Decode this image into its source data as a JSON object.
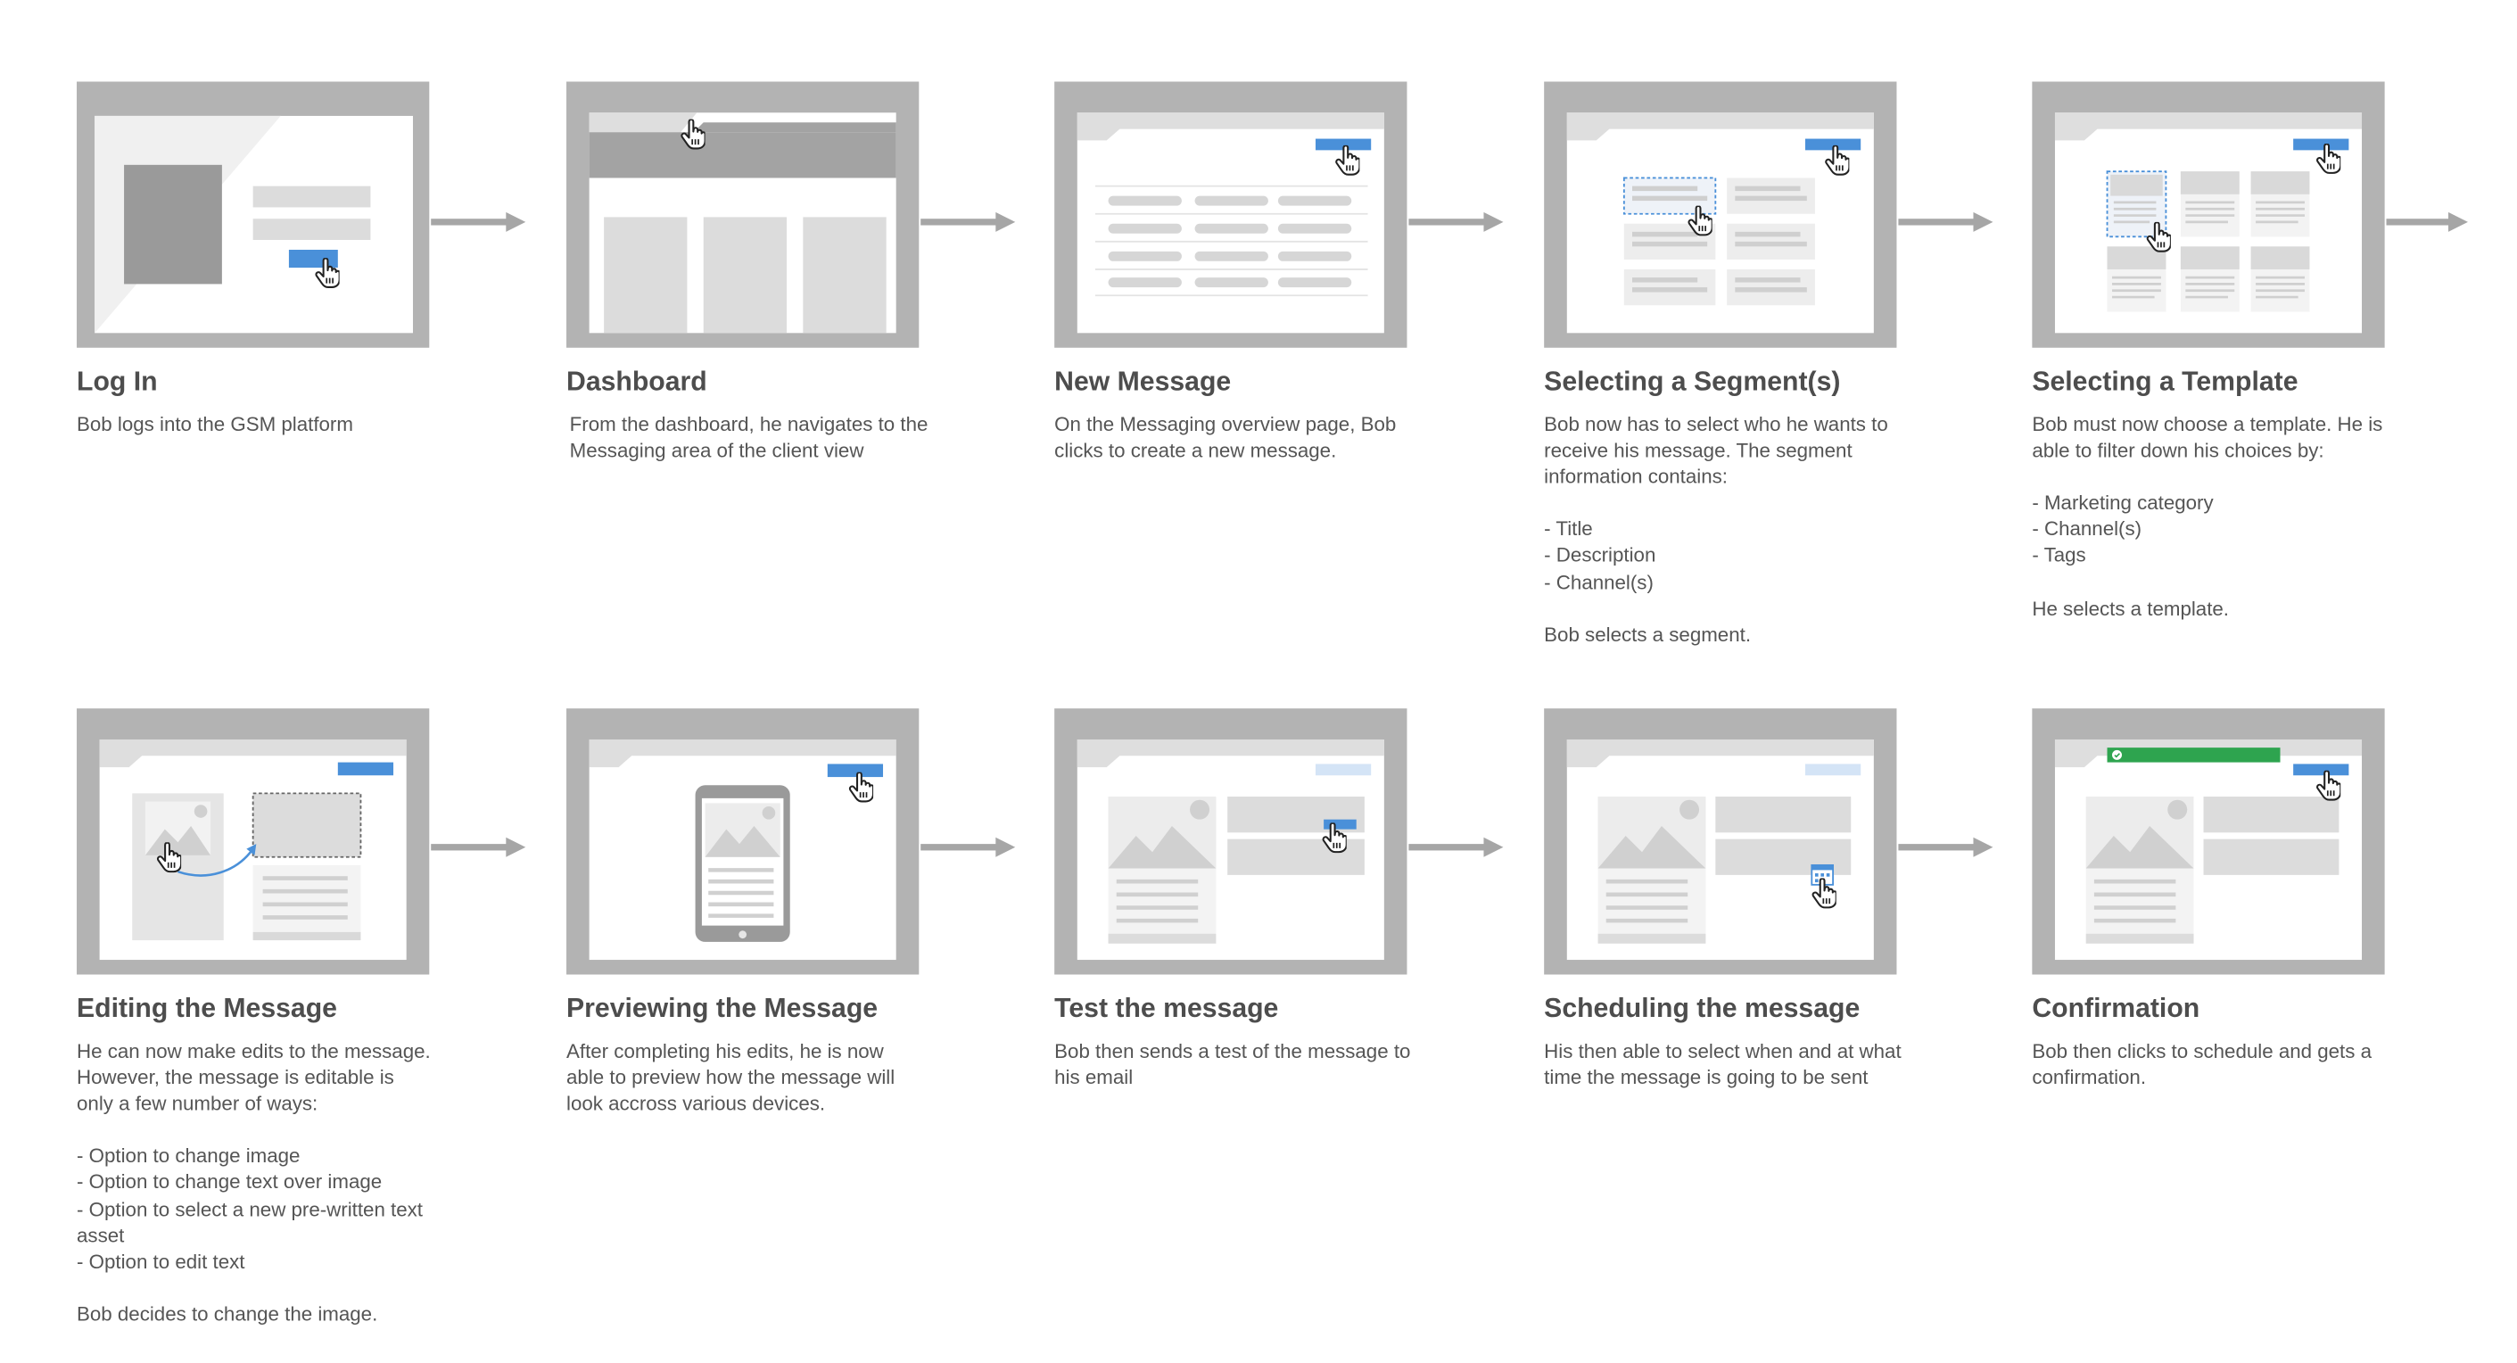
{
  "steps": [
    {
      "title": "Log In",
      "desc": "Bob logs into the GSM platform"
    },
    {
      "title": "Dashboard",
      "desc": "From the dashboard, he navigates to the Messaging area of the client view"
    },
    {
      "title": "New Message",
      "desc": "On the Messaging overview page, Bob clicks to create a new message."
    },
    {
      "title": "Selecting a Segment(s)",
      "desc": "Bob now has to select who he wants to receive his message. The segment information contains:\n\n- Title\n- Description\n- Channel(s)\n\nBob selects a segment."
    },
    {
      "title": "Selecting a Template",
      "desc": "Bob must now choose a template. He is able to filter down his choices by:\n\n- Marketing category\n- Channel(s)\n- Tags\n\nHe selects a template."
    },
    {
      "title": "Editing the Message",
      "desc": "He can now make edits to the message. However, the message is editable is only a few number of ways:\n\n- Option to change image\n- Option to change text over image\n- Option to select a new pre-written text asset\n- Option to edit text\n\nBob decides to change the image."
    },
    {
      "title": "Previewing the Message",
      "desc": "After completing his edits, he is now able to preview how the message will look accross various devices."
    },
    {
      "title": "Test the message",
      "desc": "Bob then sends a test of the message to his email"
    },
    {
      "title": "Scheduling the message",
      "desc": "His then able to select when and at what time the message is going to be sent"
    },
    {
      "title": "Confirmation",
      "desc": "Bob then clicks to schedule and gets a confirmation."
    }
  ],
  "icons": {
    "cursor": "hand-pointer-icon",
    "calendar": "calendar-icon",
    "check": "check-icon"
  },
  "colors": {
    "frame": "#b3b3b3",
    "accent": "#4a90d9",
    "success": "#2ea44f",
    "placeholder": "#d9d9d9"
  }
}
